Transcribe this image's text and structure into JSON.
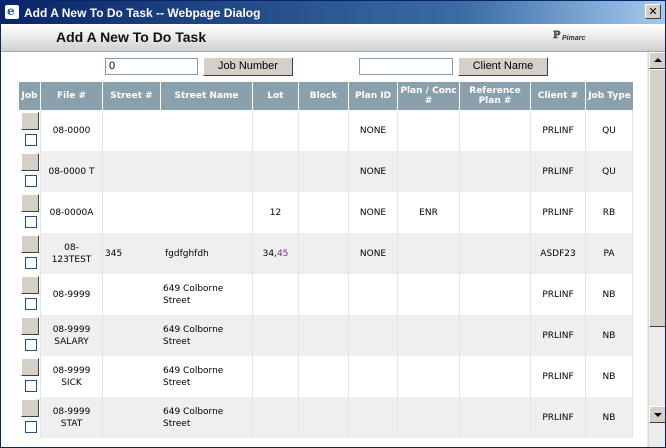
{
  "window": {
    "title": "Add A New To Do Task -- Webpage Dialog",
    "close_glyph": "✕"
  },
  "header": {
    "title": "Add A New To Do Task",
    "logo_text": "Pimarc"
  },
  "search": {
    "job_number_value": "0",
    "job_number_button": "Job Number",
    "client_name_value": "",
    "client_name_button": "Client Name"
  },
  "table": {
    "columns": [
      "Job",
      "File #",
      "Street #",
      "Street Name",
      "Lot",
      "Block",
      "Plan ID",
      "Plan / Conc #",
      "Reference Plan #",
      "Client #",
      "Job Type"
    ],
    "rows": [
      {
        "file": "08-0000",
        "street_no": "",
        "street_name": "",
        "lot": "",
        "lot_link": "",
        "block": "",
        "plan_id": "NONE",
        "plan_conc": "",
        "ref_plan": "",
        "client": "PRLINF",
        "job_type": "QU"
      },
      {
        "file": "08-0000 T",
        "street_no": "",
        "street_name": "",
        "lot": "",
        "lot_link": "",
        "block": "",
        "plan_id": "NONE",
        "plan_conc": "",
        "ref_plan": "",
        "client": "PRLINF",
        "job_type": "QU"
      },
      {
        "file": "08-0000A",
        "street_no": "",
        "street_name": "",
        "lot": "12",
        "lot_link": "",
        "block": "",
        "plan_id": "NONE",
        "plan_conc": "ENR",
        "ref_plan": "",
        "client": "PRLINF",
        "job_type": "RB"
      },
      {
        "file": "08-123TEST",
        "street_no": "345",
        "street_name": "fgdfghfdh",
        "lot": "34, ",
        "lot_link": "45",
        "block": "",
        "plan_id": "NONE",
        "plan_conc": "",
        "ref_plan": "",
        "client": "ASDF23",
        "job_type": "PA"
      },
      {
        "file": "08-9999",
        "street_no": "",
        "street_name": "649 Colborne Street",
        "lot": "",
        "lot_link": "",
        "block": "",
        "plan_id": "",
        "plan_conc": "",
        "ref_plan": "",
        "client": "PRLINF",
        "job_type": "NB"
      },
      {
        "file": "08-9999 SALARY",
        "street_no": "",
        "street_name": "649 Colborne Street",
        "lot": "",
        "lot_link": "",
        "block": "",
        "plan_id": "",
        "plan_conc": "",
        "ref_plan": "",
        "client": "PRLINF",
        "job_type": "NB"
      },
      {
        "file": "08-9999 SICK",
        "street_no": "",
        "street_name": "649 Colborne Street",
        "lot": "",
        "lot_link": "",
        "block": "",
        "plan_id": "",
        "plan_conc": "",
        "ref_plan": "",
        "client": "PRLINF",
        "job_type": "NB"
      },
      {
        "file": "08-9999 STAT",
        "street_no": "",
        "street_name": "649 Colborne Street",
        "lot": "",
        "lot_link": "",
        "block": "",
        "plan_id": "",
        "plan_conc": "",
        "ref_plan": "",
        "client": "PRLINF",
        "job_type": "NB"
      }
    ]
  },
  "colors": {
    "title_bar": "#0a246a",
    "table_header": "#8ba0ad",
    "row_alt": "#efefef",
    "lot_link": "#8a2b8f"
  }
}
